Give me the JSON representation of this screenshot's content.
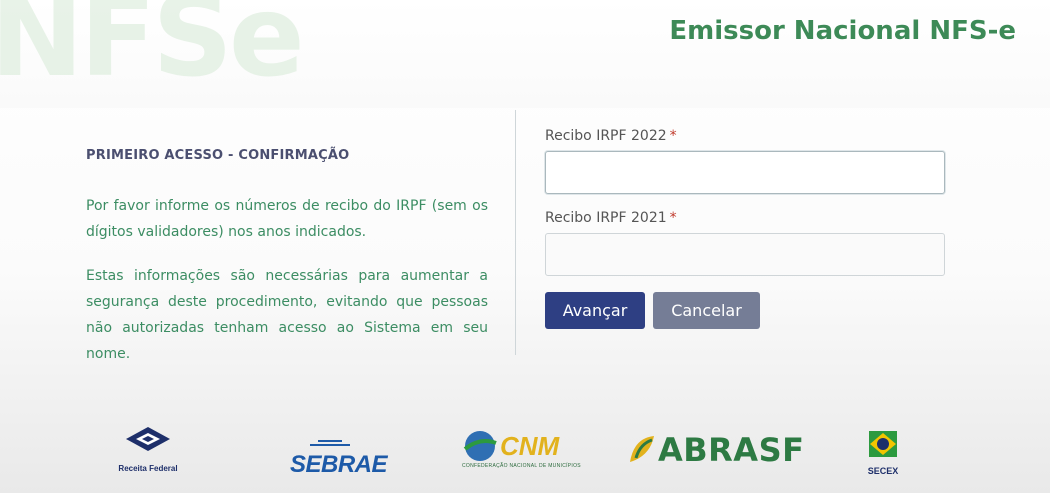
{
  "brand": {
    "watermark": "NFSe",
    "app_title": "Emissor Nacional NFS-e"
  },
  "intro": {
    "section_title": "PRIMEIRO ACESSO - CONFIRMAÇÃO",
    "paragraph1": "Por favor informe os números de recibo do IRPF (sem os dígitos validadores) nos anos indicados.",
    "paragraph2": "Estas informações são necessárias para aumentar a segurança deste procedimento, evitando que pessoas não autorizadas tenham acesso ao Sistema em seu nome."
  },
  "form": {
    "field1": {
      "label": "Recibo IRPF 2022",
      "required_mark": "*",
      "value": ""
    },
    "field2": {
      "label": "Recibo IRPF 2021",
      "required_mark": "*",
      "value": ""
    },
    "advance_label": "Avançar",
    "cancel_label": "Cancelar"
  },
  "footer_logos": {
    "receita": "Receita Federal",
    "sebrae": "SEBRAE",
    "cnm": "CNM",
    "cnm_sub": "CONFEDERAÇÃO NACIONAL DE MUNICÍPIOS",
    "abrasf": "ABRASF",
    "secex": "SECEX"
  },
  "colors": {
    "accent_green": "#3d8a57",
    "primary_button": "#2e3f83",
    "secondary_button": "#757d96"
  }
}
